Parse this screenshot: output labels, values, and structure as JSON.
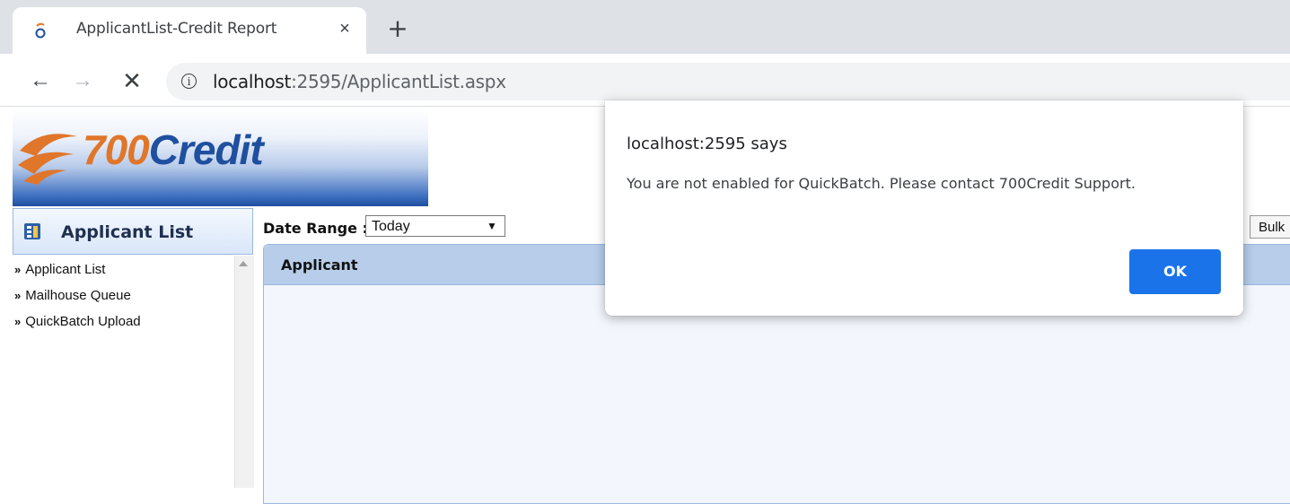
{
  "browser": {
    "tab_title": "ApplicantList-Credit Report",
    "tab_close": "×",
    "new_tab": "+",
    "nav_back": "←",
    "nav_forward": "→",
    "nav_stop": "✕",
    "info_icon": "i",
    "url_host": "localhost",
    "url_rest": ":2595/ApplicantList.aspx"
  },
  "logo": {
    "number": "700",
    "word": "Credit"
  },
  "sidebar": {
    "title": "Applicant List",
    "chevron": "»",
    "items": [
      {
        "label": "Applicant List"
      },
      {
        "label": "Mailhouse Queue"
      },
      {
        "label": "QuickBatch Upload"
      }
    ]
  },
  "filters": {
    "date_range_label": "Date Range :",
    "date_range_value": "Today",
    "select_arrow": "▼",
    "bulk_label": "Bulk"
  },
  "grid": {
    "column_header": "Applicant"
  },
  "dialog": {
    "title": "localhost:2595 says",
    "message": "You are not enabled for QuickBatch. Please contact 700Credit Support.",
    "ok_label": "OK"
  },
  "colors": {
    "accent_blue": "#1a73e8",
    "brand_orange": "#e0762a",
    "brand_blue": "#1f4f9f",
    "grid_header": "#b7cde9"
  }
}
